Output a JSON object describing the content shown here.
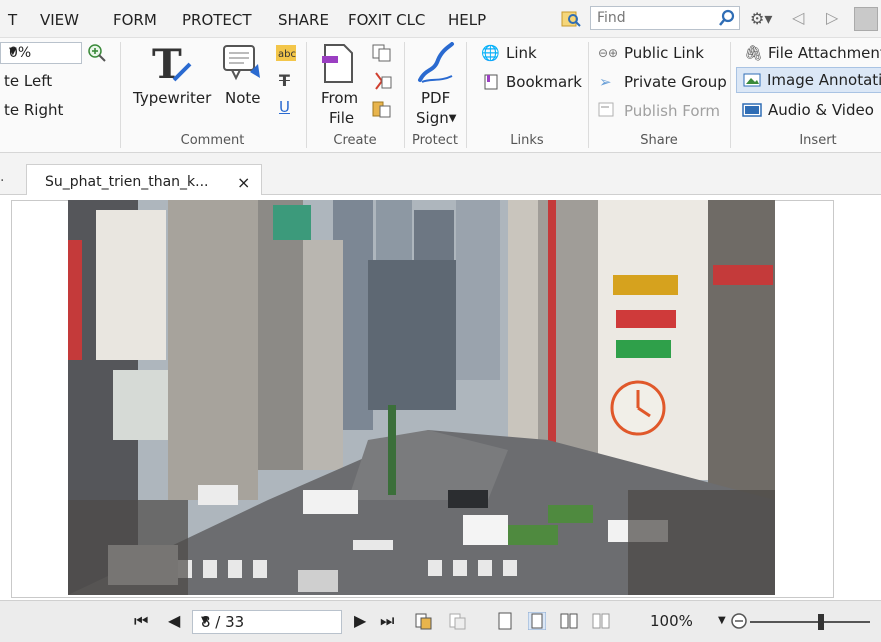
{
  "menu": {
    "items": [
      "T",
      "VIEW",
      "FORM",
      "PROTECT",
      "SHARE",
      "FOXIT CLC",
      "HELP"
    ],
    "find_placeholder": "Find"
  },
  "ribbon": {
    "zoom_value": "0%",
    "rotate_left": "te Left",
    "rotate_right": "te Right",
    "typewriter": "Typewriter",
    "note": "Note",
    "comment_label": "Comment",
    "from_file_line1": "From",
    "from_file_line2": "File",
    "create_label": "Create",
    "pdf_sign_line1": "PDF",
    "pdf_sign_line2": "Sign",
    "protect_label": "Protect",
    "link": "Link",
    "bookmark": "Bookmark",
    "links_label": "Links",
    "public_link": "Public Link",
    "private_group": "Private Group",
    "publish_form": "Publish Form",
    "share_label": "Share",
    "file_attachment": "File Attachment",
    "image_annotation": "Image Annotatic",
    "audio_video": "Audio & Video",
    "insert_label": "Insert"
  },
  "tab": {
    "stub": ".",
    "title": "Su_phat_trien_than_k...",
    "close": "×"
  },
  "navbar": {
    "page_value": "8 / 33",
    "zoom_percent": "100%"
  },
  "colors": {
    "accent_blue": "#2f6db5",
    "highlight": "#dbe7f6",
    "pen_blue": "#2a6ad0"
  }
}
